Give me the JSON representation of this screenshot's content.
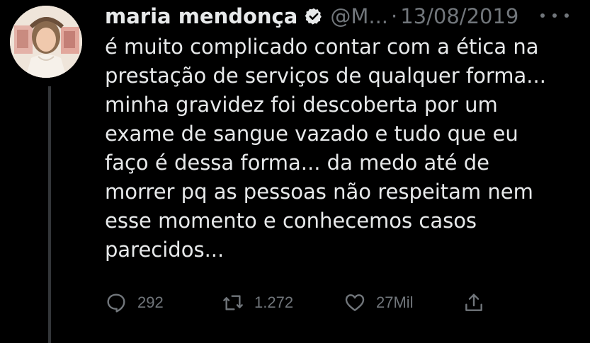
{
  "tweet": {
    "author_name": "maria mendonça",
    "handle": "@M...",
    "separator": "·",
    "date": "13/08/2019",
    "text": "é muito complicado contar com a ética na\nprestação de serviços de qualquer forma...\nminha gravidez foi descoberta por um\nexame de sangue vazado e tudo que eu\nfaço é dessa forma... da medo até de\nmorrer pq as pessoas não respeitam nem\nesse momento e conhecemos casos\nparecidos..."
  },
  "actions": {
    "reply_count": "292",
    "retweet_count": "1.272",
    "like_count": "27Mil"
  },
  "icons": {
    "verified": "verified-badge-icon",
    "more": "more-icon",
    "reply": "reply-icon",
    "retweet": "retweet-icon",
    "like": "heart-icon",
    "share": "share-icon"
  },
  "colors": {
    "background": "#000000",
    "text": "#e7e9ea",
    "secondary": "#71767b",
    "thread_line": "#333639"
  }
}
